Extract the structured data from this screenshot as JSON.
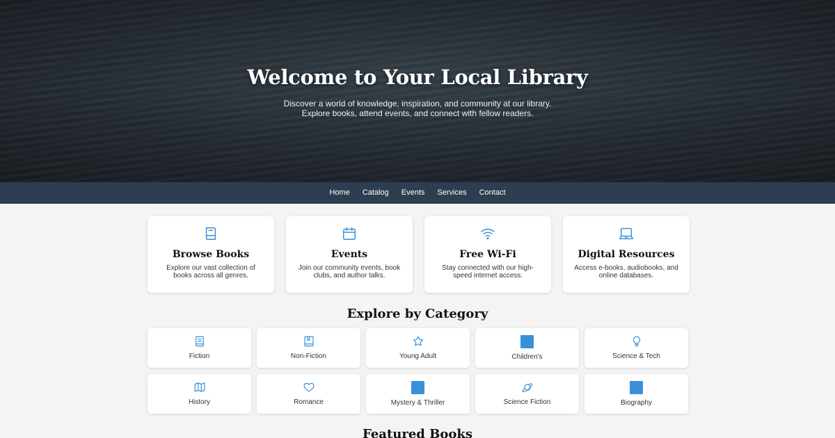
{
  "hero": {
    "title": "Welcome to Your Local Library",
    "subtitle": "Discover a world of knowledge, inspiration, and community at our library. Explore books, attend events, and connect with fellow readers."
  },
  "nav": {
    "items": [
      "Home",
      "Catalog",
      "Events",
      "Services",
      "Contact"
    ]
  },
  "features": [
    {
      "icon": "book-icon",
      "title": "Browse Books",
      "desc": "Explore our vast collection of books across all genres."
    },
    {
      "icon": "calendar-icon",
      "title": "Events",
      "desc": "Join our community events, book clubs, and author talks."
    },
    {
      "icon": "wifi-icon",
      "title": "Free Wi-Fi",
      "desc": "Stay connected with our high-speed internet access."
    },
    {
      "icon": "laptop-icon",
      "title": "Digital Resources",
      "desc": "Access e-books, audiobooks, and online databases."
    }
  ],
  "categories": {
    "title": "Explore by Category",
    "items": [
      {
        "icon": "book-icon",
        "label": "Fiction"
      },
      {
        "icon": "open-book-icon",
        "label": "Non-Fiction"
      },
      {
        "icon": "star-icon",
        "label": "Young Adult"
      },
      {
        "icon": "square-icon",
        "label": "Children's"
      },
      {
        "icon": "lightbulb-icon",
        "label": "Science & Tech"
      },
      {
        "icon": "map-icon",
        "label": "History"
      },
      {
        "icon": "heart-icon",
        "label": "Romance"
      },
      {
        "icon": "square-icon",
        "label": "Mystery & Thriller"
      },
      {
        "icon": "planet-icon",
        "label": "Science Fiction"
      },
      {
        "icon": "square-icon",
        "label": "Biography"
      }
    ]
  },
  "featured": {
    "title": "Featured Books"
  },
  "colors": {
    "accent": "#3a8fd9",
    "nav": "#2c3e50"
  }
}
